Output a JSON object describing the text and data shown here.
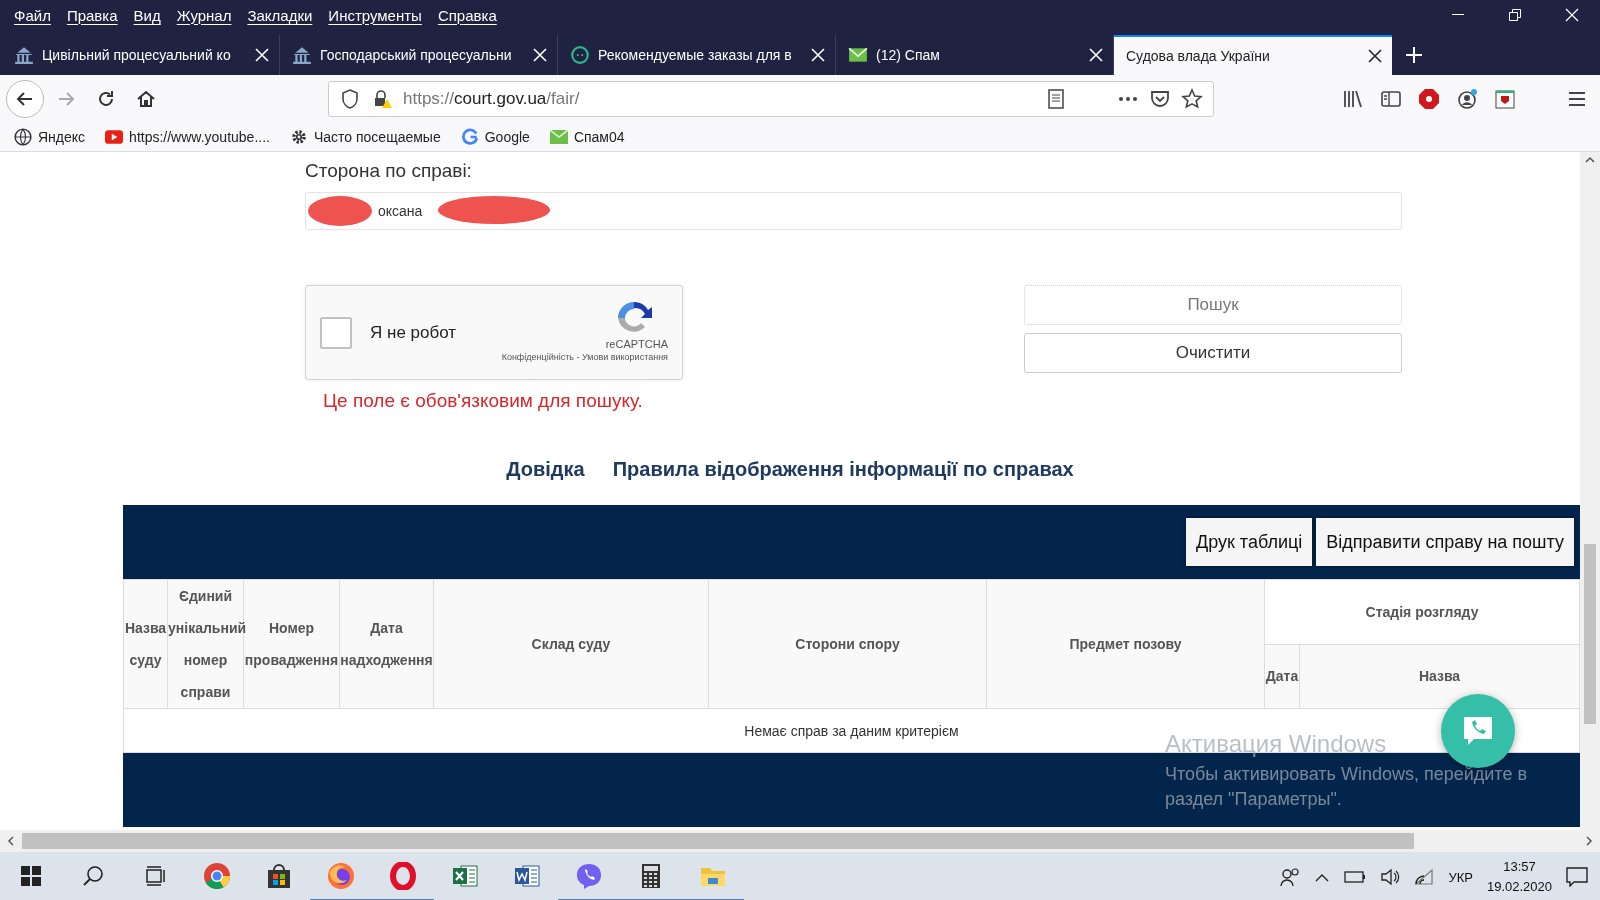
{
  "menu": [
    "Файл",
    "Правка",
    "Вид",
    "Журнал",
    "Закладки",
    "Инструменты",
    "Справка"
  ],
  "tabs": [
    {
      "label": "Цивільний процесуальний ко",
      "kind": "court",
      "selected": false
    },
    {
      "label": "Господарський процесуальни",
      "kind": "court",
      "selected": false
    },
    {
      "label": "Рекомендуемые заказы для в",
      "kind": "chat",
      "selected": false
    },
    {
      "label": "(12) Спам",
      "kind": "mail",
      "selected": false
    },
    {
      "label": "Судова влада України",
      "kind": "none",
      "selected": true
    }
  ],
  "url": {
    "prefix": "https://",
    "host": "court.gov.ua",
    "path": "/fair/"
  },
  "bookmarks": [
    {
      "label": "Яндекс",
      "kind": "globe"
    },
    {
      "label": "https://www.youtube....",
      "kind": "video"
    },
    {
      "label": "Часто посещаемые",
      "kind": "gear"
    },
    {
      "label": "Google",
      "kind": "google"
    },
    {
      "label": "Спам04",
      "kind": "mail"
    }
  ],
  "form": {
    "label": "Сторона по справі:",
    "value": "оксана"
  },
  "captcha": {
    "label": "Я не робот",
    "checked": false,
    "brand": "reCAPTCHA",
    "links": "Конфіденційність - Умови використання"
  },
  "search_button": "Пошук",
  "clear_button": "Очистити",
  "error": "Це поле є обов'язковим для пошуку.",
  "links": [
    "Довідка",
    "Правила відображення інформації по справах"
  ],
  "table": {
    "buttons": [
      "Друк таблиці",
      "Відправити справу на пошту"
    ],
    "columns": [
      "Назва суду",
      "Єдиний унікальний номер справи",
      "Номер провадження",
      "Дата надходження",
      "Склад суду",
      "Сторони спору",
      "Предмет позову"
    ],
    "group": {
      "label": "Стадія розгляду",
      "columns": [
        "Дата",
        "Назва"
      ]
    },
    "empty_text": "Немає справ за даним критерієм"
  },
  "watermark": {
    "title": "Активация Windows",
    "text": "Чтобы активировать Windows, перейдите в раздел \"Параметры\"."
  },
  "taskbar": {
    "items": [
      {
        "kind": "chrome",
        "running": false
      },
      {
        "kind": "store",
        "running": false
      },
      {
        "kind": "firefox",
        "running": true
      },
      {
        "kind": "opera",
        "running": true
      },
      {
        "kind": "excel",
        "running": false
      },
      {
        "kind": "word",
        "running": false
      },
      {
        "kind": "viber",
        "running": true
      },
      {
        "kind": "calculator",
        "running": true
      },
      {
        "kind": "explorer",
        "running": true
      }
    ],
    "lang": "УКР",
    "time": "13:57",
    "date": "19.02.2020"
  }
}
